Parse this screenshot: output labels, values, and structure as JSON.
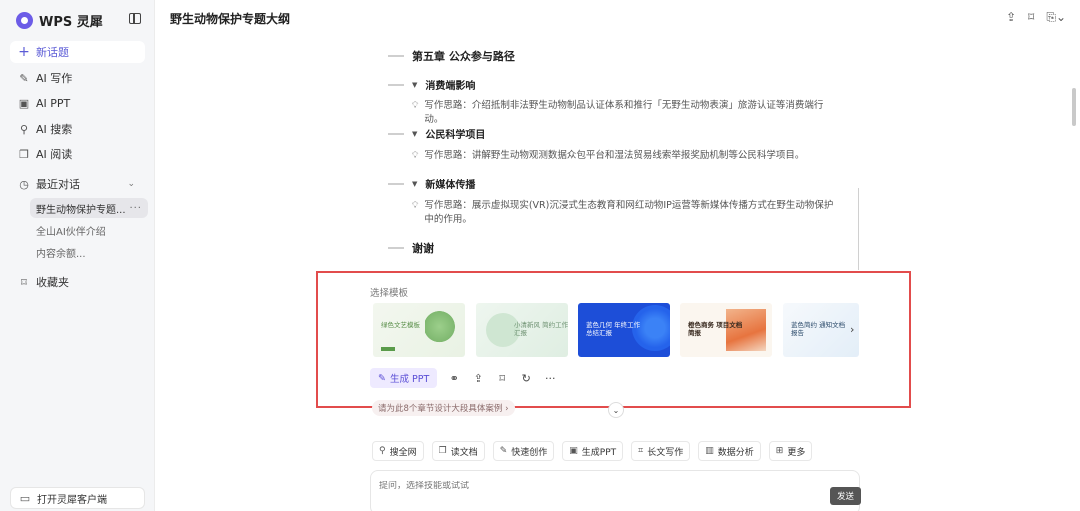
{
  "sidebar": {
    "brand": "WPS 灵犀",
    "new_chat": "新话题",
    "items": [
      {
        "label": "AI 写作",
        "icon": "pen-icon"
      },
      {
        "label": "AI PPT",
        "icon": "ppt-icon"
      },
      {
        "label": "AI 搜索",
        "icon": "search-icon"
      },
      {
        "label": "AI 阅读",
        "icon": "book-icon"
      }
    ],
    "recent_label": "最近对话",
    "recent_items": [
      "野生动物保护专题...",
      "全山AI伙伴介绍",
      "内容余额..."
    ],
    "favorites": "收藏夹",
    "open_client": "打开灵犀客户端"
  },
  "header": {
    "title": "野生动物保护专题大纲"
  },
  "outline": {
    "chapter": "第五章 公众参与路径",
    "sections": [
      {
        "title": "消费端影响",
        "note": "写作思路：介绍抵制非法野生动物制品认证体系和推行「无野生动物表演」旅游认证等消费端行动。"
      },
      {
        "title": "公民科学项目",
        "note": "写作思路：讲解野生动物观测数据众包平台和湿法贸易线索举报奖励机制等公民科学项目。"
      },
      {
        "title": "新媒体传播",
        "note": "写作思路：展示虚拟现实(VR)沉浸式生态教育和网红动物IP运营等新媒体传播方式在野生动物保护中的作用。"
      }
    ],
    "closing": "谢谢"
  },
  "templates": {
    "label": "选择模板",
    "items": [
      {
        "text": "绿色文艺模板"
      },
      {
        "text": "小清新风 简约工作汇报"
      },
      {
        "text": "蓝色几何 年终工作总结汇报"
      },
      {
        "text": "橙色商务 项目文档简报"
      },
      {
        "text": "蓝色简约 通知文档报告"
      }
    ]
  },
  "actions": {
    "generate": "生成 PPT",
    "more": "···"
  },
  "hint": "请为此8个章节设计大段具体案例 ›",
  "tools": [
    "搜全网",
    "读文档",
    "快速创作",
    "生成PPT",
    "长文写作",
    "数据分析",
    "更多"
  ],
  "composer": {
    "placeholder": "提问，选择技能或试试"
  },
  "send_label": "发送"
}
